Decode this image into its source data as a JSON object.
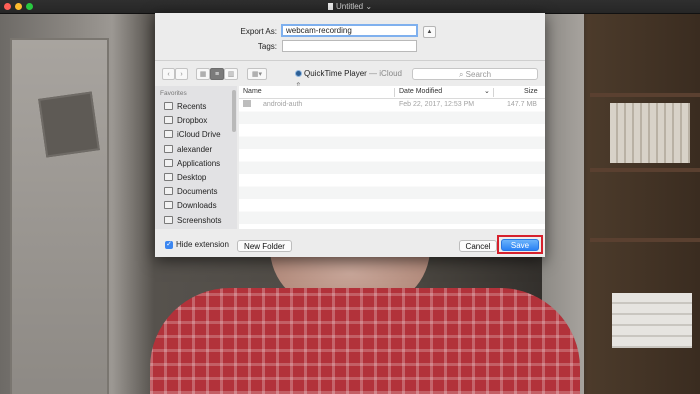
{
  "window": {
    "title": "Untitled",
    "colors": {
      "close": "#ff5f57",
      "minimize": "#febc2e",
      "maximize": "#28c840"
    }
  },
  "dialog": {
    "export_as_label": "Export As:",
    "export_as_value": "webcam-recording",
    "tags_label": "Tags:",
    "tags_value": "",
    "toolbar": {
      "back": "<",
      "forward": ">",
      "icon_view": "icon-view",
      "list_view": "list-view",
      "column_view": "column-view",
      "group_menu": "group-menu"
    },
    "location": {
      "app": "QuickTime Player",
      "separator": " — ",
      "place": "iCloud"
    },
    "search_placeholder": "Search",
    "sidebar": {
      "heading": "Favorites",
      "items": [
        {
          "label": "Recents",
          "icon": "clock-icon"
        },
        {
          "label": "Dropbox",
          "icon": "dropbox-icon"
        },
        {
          "label": "iCloud Drive",
          "icon": "cloud-icon"
        },
        {
          "label": "alexander",
          "icon": "home-icon"
        },
        {
          "label": "Applications",
          "icon": "applications-icon"
        },
        {
          "label": "Desktop",
          "icon": "desktop-icon"
        },
        {
          "label": "Documents",
          "icon": "documents-icon"
        },
        {
          "label": "Downloads",
          "icon": "downloads-icon"
        },
        {
          "label": "Screenshots",
          "icon": "folder-icon"
        }
      ]
    },
    "table": {
      "columns": [
        "Name",
        "Date Modified",
        "Size"
      ],
      "rows": [
        {
          "name": "android-auth",
          "date": "Feb 22, 2017, 12:53 PM",
          "size": "147.7 MB"
        }
      ]
    },
    "hide_extension_label": "Hide extension",
    "hide_extension_checked": true,
    "new_folder_label": "New Folder",
    "cancel_label": "Cancel",
    "save_label": "Save",
    "accent_color": "#2a82f5",
    "highlight_color": "#d6202c"
  }
}
